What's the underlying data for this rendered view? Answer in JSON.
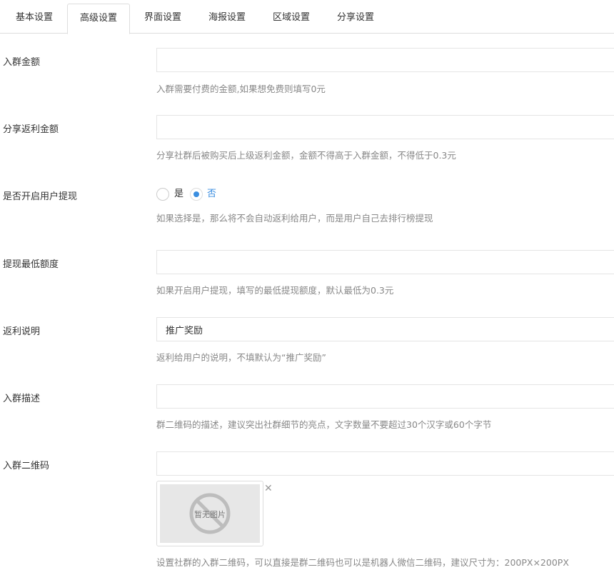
{
  "tabs": [
    {
      "label": "基本设置",
      "active": false
    },
    {
      "label": "高级设置",
      "active": true
    },
    {
      "label": "界面设置",
      "active": false
    },
    {
      "label": "海报设置",
      "active": false
    },
    {
      "label": "区域设置",
      "active": false
    },
    {
      "label": "分享设置",
      "active": false
    }
  ],
  "form": {
    "join_amount": {
      "label": "入群金额",
      "value": "",
      "help": "入群需要付费的金额,如果想免费则填写0元"
    },
    "share_rebate": {
      "label": "分享返利金额",
      "value": "",
      "help": "分享社群后被购买后上级返利金额，金额不得高于入群金额，不得低于0.3元"
    },
    "withdraw_enabled": {
      "label": "是否开启用户提现",
      "option_yes": "是",
      "option_no": "否",
      "selected": "否",
      "help": "如果选择是，那么将不会自动返利给用户，而是用户自己去排行榜提现"
    },
    "min_withdraw": {
      "label": "提现最低额度",
      "value": "",
      "help": "如果开启用户提现，填写的最低提现额度，默认最低为0.3元"
    },
    "rebate_note": {
      "label": "返利说明",
      "value": "推广奖励",
      "help": "返利给用户的说明，不填默认为“推广奖励”"
    },
    "join_desc": {
      "label": "入群描述",
      "value": "",
      "help": "群二维码的描述，建议突出社群细节的亮点，文字数量不要超过30个汉字或60个字节"
    },
    "join_qrcode": {
      "label": "入群二维码",
      "value": "",
      "placeholder_image_text": "暂无图片",
      "remove_icon": "close-icon",
      "help": "设置社群的入群二维码，可以直接是群二维码也可以是机器人微信二维码，建议尺寸为：200PX×200PX"
    }
  },
  "colors": {
    "accent": "#3b8ee0",
    "border": "#dddddd",
    "help_text": "#888888"
  }
}
